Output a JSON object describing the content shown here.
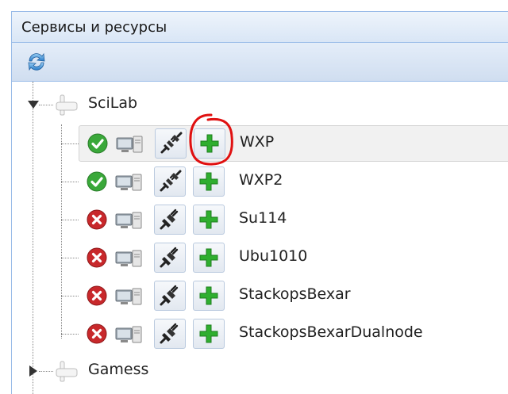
{
  "panel": {
    "title": "Сервисы и ресурсы"
  },
  "toolbar": {
    "refresh_icon": "refresh-icon"
  },
  "tree": {
    "groups": [
      {
        "label": "SciLab",
        "expanded": true
      },
      {
        "label": "Gamess",
        "expanded": false
      }
    ],
    "machines": [
      {
        "name": "WXP",
        "status": "online",
        "connected": true,
        "selected": true
      },
      {
        "name": "WXP2",
        "status": "online",
        "connected": true,
        "selected": false
      },
      {
        "name": "Su114",
        "status": "offline",
        "connected": false,
        "selected": false
      },
      {
        "name": "Ubu1010",
        "status": "offline",
        "connected": false,
        "selected": false
      },
      {
        "name": "StackopsBexar",
        "status": "offline",
        "connected": false,
        "selected": false
      },
      {
        "name": "StackopsBexarDualnode",
        "status": "offline",
        "connected": false,
        "selected": false
      }
    ]
  },
  "colors": {
    "online": "#3aa83a",
    "offline": "#c8282b",
    "add": "#2fae2f",
    "annotation": "#e01010",
    "header_border": "#99bbe8"
  }
}
